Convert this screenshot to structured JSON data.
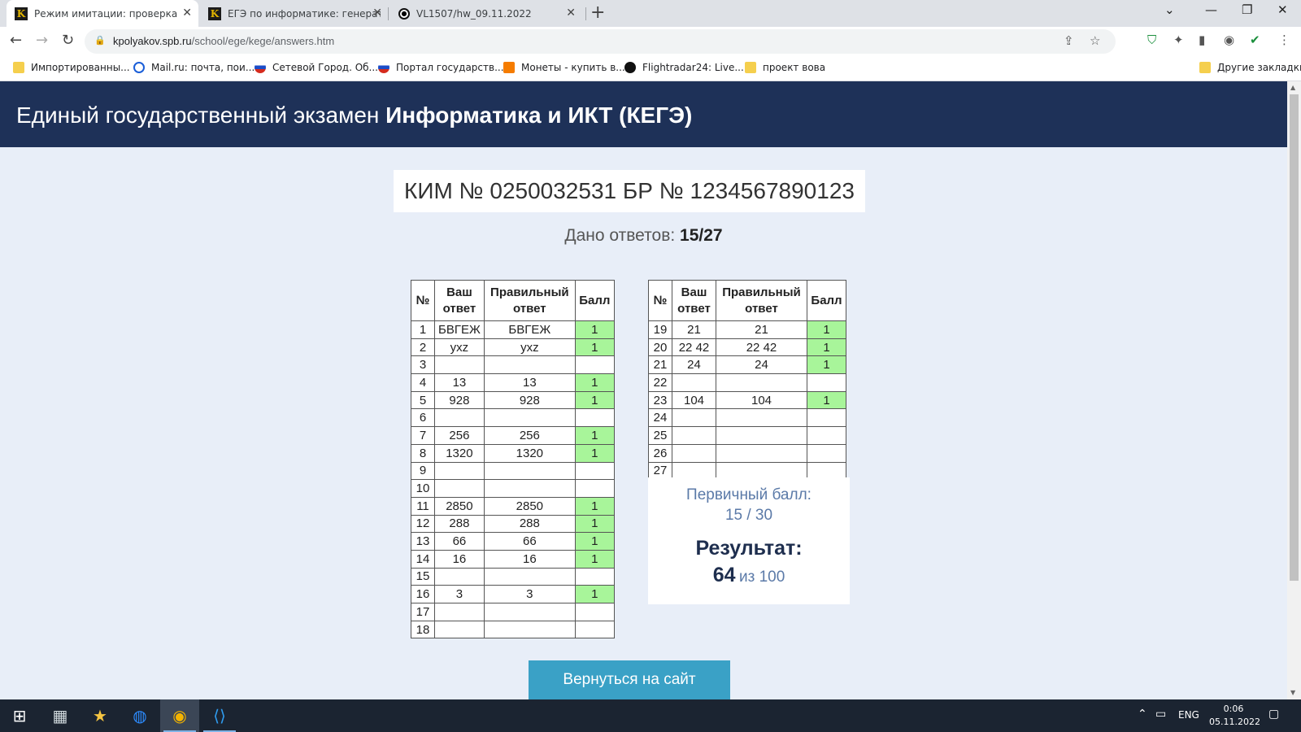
{
  "browser": {
    "tabs": [
      {
        "title": "Режим имитации: проверка ответов",
        "active": true,
        "icon": "k-favicon"
      },
      {
        "title": "ЕГЭ по информатике: генератор",
        "active": false,
        "icon": "k-favicon"
      },
      {
        "title": "VL1507/hw_09.11.2022",
        "active": false,
        "icon": "github-icon"
      }
    ],
    "url_host": "kpolyakov.spb.ru",
    "url_path": "/school/ege/kege/answers.htm",
    "bookmarks": [
      {
        "label": "Импортированны...",
        "icon": "folder"
      },
      {
        "label": "Mail.ru: почта, пои...",
        "icon": "mail"
      },
      {
        "label": "Сетевой Город. Об...",
        "icon": "ru-flag"
      },
      {
        "label": "Портал государств...",
        "icon": "ru-flag"
      },
      {
        "label": "Монеты - купить в...",
        "icon": "coin"
      },
      {
        "label": "Flightradar24: Live...",
        "icon": "flightradar"
      },
      {
        "label": "проект вова",
        "icon": "folder"
      }
    ],
    "other_bookmarks": "Другие закладки"
  },
  "page": {
    "banner_prefix": "Единый государственный экзамен",
    "banner_bold": "Информатика и ИКТ (КЕГЭ)",
    "kim_title": "КИМ № 0250032531 БР № 1234567890123",
    "given_label": "Дано ответов:",
    "given_value": "15/27",
    "headers": {
      "num": "№",
      "yours": "Ваш ответ",
      "correct": "Правильный ответ",
      "score": "Балл"
    },
    "rows_left": [
      {
        "n": "1",
        "yours": "БВГЕЖ",
        "correct": "БВГЕЖ",
        "score": "1"
      },
      {
        "n": "2",
        "yours": "yxz",
        "correct": "yxz",
        "score": "1"
      },
      {
        "n": "3",
        "yours": "",
        "correct": "",
        "score": ""
      },
      {
        "n": "4",
        "yours": "13",
        "correct": "13",
        "score": "1"
      },
      {
        "n": "5",
        "yours": "928",
        "correct": "928",
        "score": "1"
      },
      {
        "n": "6",
        "yours": "",
        "correct": "",
        "score": ""
      },
      {
        "n": "7",
        "yours": "256",
        "correct": "256",
        "score": "1"
      },
      {
        "n": "8",
        "yours": "1320",
        "correct": "1320",
        "score": "1"
      },
      {
        "n": "9",
        "yours": "",
        "correct": "",
        "score": ""
      },
      {
        "n": "10",
        "yours": "",
        "correct": "",
        "score": ""
      },
      {
        "n": "11",
        "yours": "2850",
        "correct": "2850",
        "score": "1"
      },
      {
        "n": "12",
        "yours": "288",
        "correct": "288",
        "score": "1"
      },
      {
        "n": "13",
        "yours": "66",
        "correct": "66",
        "score": "1"
      },
      {
        "n": "14",
        "yours": "16",
        "correct": "16",
        "score": "1"
      },
      {
        "n": "15",
        "yours": "",
        "correct": "",
        "score": ""
      },
      {
        "n": "16",
        "yours": "3",
        "correct": "3",
        "score": "1"
      },
      {
        "n": "17",
        "yours": "",
        "correct": "",
        "score": ""
      },
      {
        "n": "18",
        "yours": "",
        "correct": "",
        "score": ""
      }
    ],
    "rows_right": [
      {
        "n": "19",
        "yours": "21",
        "correct": "21",
        "score": "1"
      },
      {
        "n": "20",
        "yours": "22 42",
        "correct": "22 42",
        "score": "1"
      },
      {
        "n": "21",
        "yours": "24",
        "correct": "24",
        "score": "1"
      },
      {
        "n": "22",
        "yours": "",
        "correct": "",
        "score": ""
      },
      {
        "n": "23",
        "yours": "104",
        "correct": "104",
        "score": "1"
      },
      {
        "n": "24",
        "yours": "",
        "correct": "",
        "score": ""
      },
      {
        "n": "25",
        "yours": "",
        "correct": "",
        "score": ""
      },
      {
        "n": "26",
        "yours": "",
        "correct": "",
        "score": ""
      },
      {
        "n": "27",
        "yours": "",
        "correct": "",
        "score": ""
      }
    ],
    "primary_label": "Первичный балл:",
    "primary_value": "15 / 30",
    "result_label": "Результат:",
    "result_value": "64",
    "result_of": "из 100",
    "back_button": "Вернуться на сайт"
  },
  "colors": {
    "banner": "#1e3158",
    "page_bg": "#e8eef8",
    "score_ok": "#a8f59a",
    "button": "#3aa1c6"
  },
  "taskbar": {
    "apps": [
      "windows-start-icon",
      "calculator-icon",
      "game-icon",
      "zoom-icon",
      "browser-icon",
      "vscode-icon"
    ],
    "lang": "ENG",
    "time": "0:06",
    "date": "05.11.2022"
  }
}
